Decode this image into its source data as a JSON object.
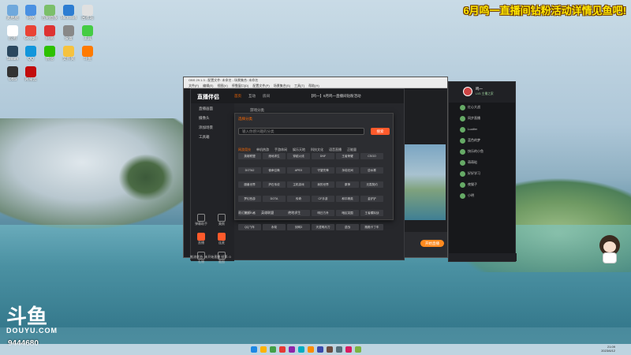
{
  "banner": "6月鸣一直播间钻粉活动详情见鱼吧!",
  "logo": {
    "mark": "斗鱼",
    "word": "DOUYU.COM"
  },
  "room_id": "9444680",
  "desktop": {
    "icons": [
      {
        "label": "此电脑",
        "color": "#6fa8dc"
      },
      {
        "label": "网络",
        "color": "#4a90e2"
      },
      {
        "label": "控制面板",
        "color": "#7bbf6a"
      },
      {
        "label": "Microsoft",
        "color": "#2d7dd2"
      },
      {
        "label": "回收站",
        "color": "#e0e0e0"
      },
      {
        "label": "应用",
        "color": "#ffffff"
      },
      {
        "label": "Google",
        "color": "#e94335"
      },
      {
        "label": "网易",
        "color": "#d33"
      },
      {
        "label": "设置",
        "color": "#888"
      },
      {
        "label": "工具",
        "color": "#4c4"
      },
      {
        "label": "Steam",
        "color": "#2a475e"
      },
      {
        "label": "QQ",
        "color": "#1296db"
      },
      {
        "label": "微信",
        "color": "#2dc100"
      },
      {
        "label": "文件夹",
        "color": "#f6c23e"
      },
      {
        "label": "斗鱼",
        "color": "#ff7a00"
      },
      {
        "label": "OBS",
        "color": "#333"
      },
      {
        "label": "网易云",
        "color": "#c20c0c"
      }
    ]
  },
  "obs": {
    "title": "OBS 29.1.3 - 配置文件: 未命名 - 场景集合: 未命名",
    "menu": [
      "文件(F)",
      "编辑(E)",
      "视图(V)",
      "停靠窗口(D)",
      "配置文件(P)",
      "场景集合(S)",
      "工具(T)",
      "帮助(H)"
    ],
    "tools": [
      "直播间管理",
      "弹幕",
      "主播任务",
      "礼物",
      "分享",
      "更多"
    ],
    "start_label": "开始直播"
  },
  "assistant": {
    "brand": "直播伴侣",
    "tabs": [
      {
        "label": "首页",
        "active": true
      },
      {
        "label": "互动",
        "active": false
      },
      {
        "label": "房间",
        "active": false
      }
    ],
    "room_title": "【鸣一】6月鸣一直播间钻粉活动",
    "category_label": "游戏分类",
    "sidebar": [
      "直播画面",
      "摄像头",
      "添加场景",
      "工具箱"
    ],
    "tiles": [
      {
        "label": "弹幕助手",
        "hot": false
      },
      {
        "label": "美颜",
        "hot": false
      },
      {
        "label": "直播",
        "hot": true
      },
      {
        "label": "连麦",
        "hot": true
      },
      {
        "label": "礼物",
        "hot": false
      },
      {
        "label": "截图",
        "hot": false
      }
    ],
    "status": "推流状态: 未开始直播 帧率: 0"
  },
  "category_popup": {
    "tag": "选择分类",
    "search_placeholder": "输入你感兴趣的分类",
    "search_button": "搜索",
    "tabs": [
      {
        "label": "网游竞技",
        "active": true
      },
      {
        "label": "单机热游",
        "active": false
      },
      {
        "label": "手游休闲",
        "active": false
      },
      {
        "label": "娱乐天地",
        "active": false
      },
      {
        "label": "科技文化",
        "active": false
      },
      {
        "label": "语音直播",
        "active": false
      },
      {
        "label": "正能量",
        "active": false
      }
    ],
    "cells": [
      "英雄联盟",
      "绝地求生",
      "穿越火线",
      "DNF",
      "王者荣耀",
      "CSGO",
      "DOTA2",
      "使命召唤",
      "APEX",
      "守望先锋",
      "永劫无间",
      "逆水寒",
      "魔兽世界",
      "炉石传说",
      "主机游戏",
      "我的世界",
      "原神",
      "无畏契约",
      "梦幻西游",
      "DOTA",
      "传奇",
      "CF手游",
      "和平精英",
      "金铲铲",
      "第五人格",
      "崩坏",
      "火影忍者",
      "明日方舟",
      "暗区突围",
      "王者模拟战",
      "QQ飞车",
      "永劫",
      "剑网3",
      "天涯明月刀",
      "逆战",
      "跑跑卡丁车"
    ],
    "recent_label": "最近选择",
    "recent": [
      "英雄联盟",
      "绝地求生"
    ]
  },
  "chat": {
    "name": "鸣一",
    "subtitle": "LV5 主播之家",
    "rows": [
      "红心大战",
      "同步直播",
      "Lucifer",
      "蓝色的梦",
      "快乐的小鱼",
      "萌萌哒",
      "好好学习",
      "夜猫子",
      "小明"
    ]
  },
  "taskbar": {
    "time": "21:09",
    "date": "2023/6/12"
  }
}
